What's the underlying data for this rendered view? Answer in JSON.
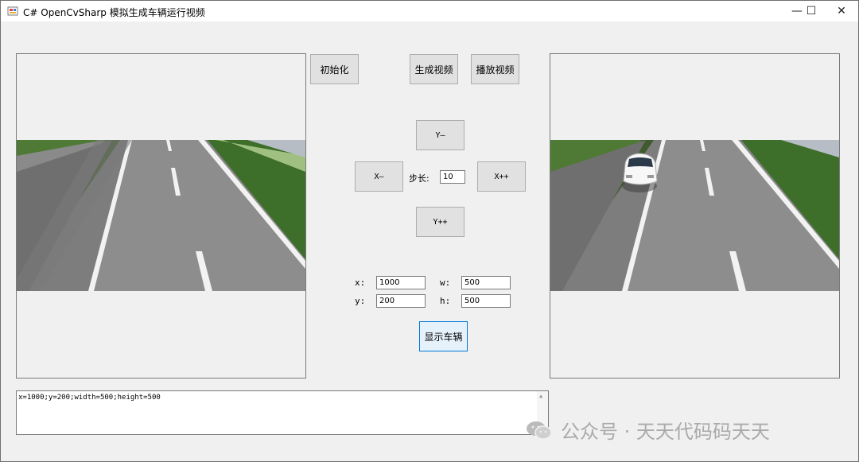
{
  "window": {
    "title": "C# OpenCvSharp 模拟生成车辆运行视频",
    "controls": {
      "minimize": "—",
      "maximize": "☐",
      "close": "✕"
    }
  },
  "buttons": {
    "init": "初始化",
    "generate": "生成视频",
    "play": "播放视频",
    "y_minus": "Y—",
    "x_minus": "X—",
    "x_plus": "X++",
    "y_plus": "Y++",
    "show_vehicle": "显示车辆"
  },
  "step": {
    "label": "步长:",
    "value": "10"
  },
  "fields": {
    "x": {
      "label": "x:",
      "value": "1000"
    },
    "y": {
      "label": "y:",
      "value": "200"
    },
    "w": {
      "label": "w:",
      "value": "500"
    },
    "h": {
      "label": "h:",
      "value": "500"
    }
  },
  "log": {
    "text": "x=1000;y=200;width=500;height=500"
  },
  "watermark": {
    "text": "公众号 · 天天代码码天天"
  },
  "icons": {
    "app": "app-icon",
    "watermark": "wechat-icon"
  }
}
